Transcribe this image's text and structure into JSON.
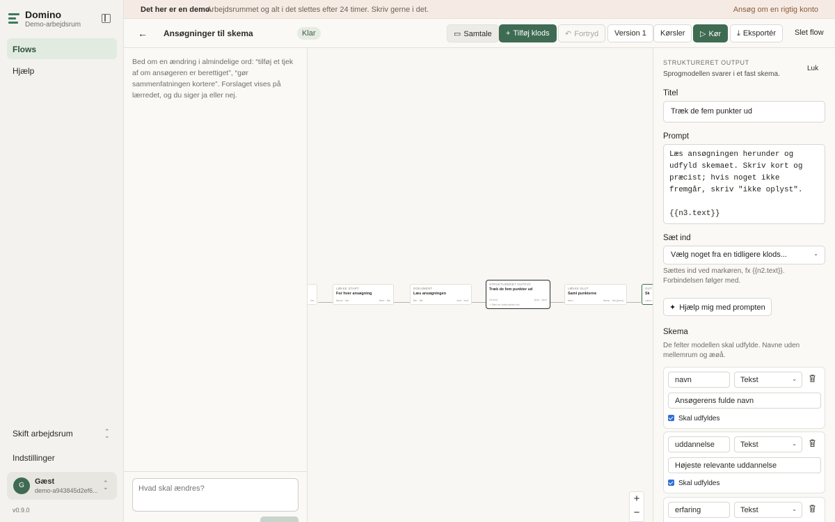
{
  "app": {
    "name": "Domino",
    "workspace": "Demo-arbejdsrum",
    "version": "v0.9.0"
  },
  "sidebar": {
    "nav": [
      {
        "label": "Flows",
        "active": true
      },
      {
        "label": "Hjælp",
        "active": false
      }
    ],
    "switch_workspace": "Skift arbejdsrum",
    "settings": "Indstillinger",
    "user": {
      "initial": "G",
      "name": "Gæst",
      "id": "demo-a943845d2ef6..."
    }
  },
  "banner": {
    "bold": "Det her er en demo.",
    "text": "Arbejdsrummet og alt i det slettes efter 24 timer. Skriv gerne i det.",
    "link": "Ansøg om en rigtig konto"
  },
  "toolbar": {
    "title": "Ansøgninger til skema",
    "status": "Klar",
    "chat": "Samtale",
    "add_block": "Tilføj klods",
    "undo": "Fortryd",
    "version": "Version 1",
    "runs": "Kørsler",
    "run": "Kør",
    "export": "Eksportér",
    "delete": "Slet flow"
  },
  "chat": {
    "hint": "Bed om en ændring i almindelige ord: “tilføj et tjek af om ansøgeren er berettiget”, “gør sammenfatningen kortere”. Forslaget vises på lærredet, og du siger ja eller nej.",
    "placeholder": "Hvad skal ændres?"
  },
  "canvas": {
    "nodes": [
      {
        "kind": "",
        "title": "",
        "p1": "",
        "p2": "fra"
      },
      {
        "kind": "LØKKE START",
        "title": "For hver ansøgning",
        "p1": "items · list",
        "p2": "item · file"
      },
      {
        "kind": "DOKUMENT",
        "title": "Læs ansøgningen",
        "p1": "file · file",
        "p2": "text · text"
      },
      {
        "kind": "STRUKTURERET OUTPUT",
        "title": "Træk de fem punkter ud",
        "p1": "n3.text",
        "p2": "json · json",
        "extra": "+ Sæt en forbindelse ind"
      },
      {
        "kind": "LØKKE SLUT",
        "title": "Saml punkterne",
        "p1": "item",
        "p2": "items · list (json)"
      },
      {
        "kind": "OUT",
        "title": "Sk",
        "p1": "value",
        "p2": ""
      }
    ],
    "zoom_in": "+",
    "zoom_out": "−"
  },
  "panel": {
    "type": "STRUKTURERET OUTPUT",
    "desc": "Sprogmodellen svarer i et fast skema.",
    "close": "Luk",
    "title_label": "Titel",
    "title_value": "Træk de fem punkter ud",
    "prompt_label": "Prompt",
    "prompt_value": "Læs ansøgningen herunder og udfyld skemaet. Skriv kort og præcist; hvis noget ikke fremgår, skriv \"ikke oplyst\".\n\n{{n3.text}}",
    "insert_label": "Sæt ind",
    "insert_select": "Vælg noget fra en tidligere klods...",
    "insert_help": "Sættes ind ved markøren, fx {{n2.text}}. Forbindelsen følger med.",
    "help_button": "Hjælp mig med prompten",
    "schema_label": "Skema",
    "schema_help": "De felter modellen skal udfylde. Navne uden mellemrum og æøå.",
    "fields": [
      {
        "name": "navn",
        "type": "Tekst",
        "desc": "Ansøgerens fulde navn",
        "required": "Skal udfyldes"
      },
      {
        "name": "uddannelse",
        "type": "Tekst",
        "desc": "Højeste relevante uddannelse",
        "required": "Skal udfyldes"
      },
      {
        "name": "erfaring",
        "type": "Tekst",
        "desc": "",
        "required": ""
      }
    ]
  },
  "colors": {
    "accent": "#3e6b52",
    "banner": "#f6ebe4",
    "checkbox": "#2f6fd6"
  }
}
